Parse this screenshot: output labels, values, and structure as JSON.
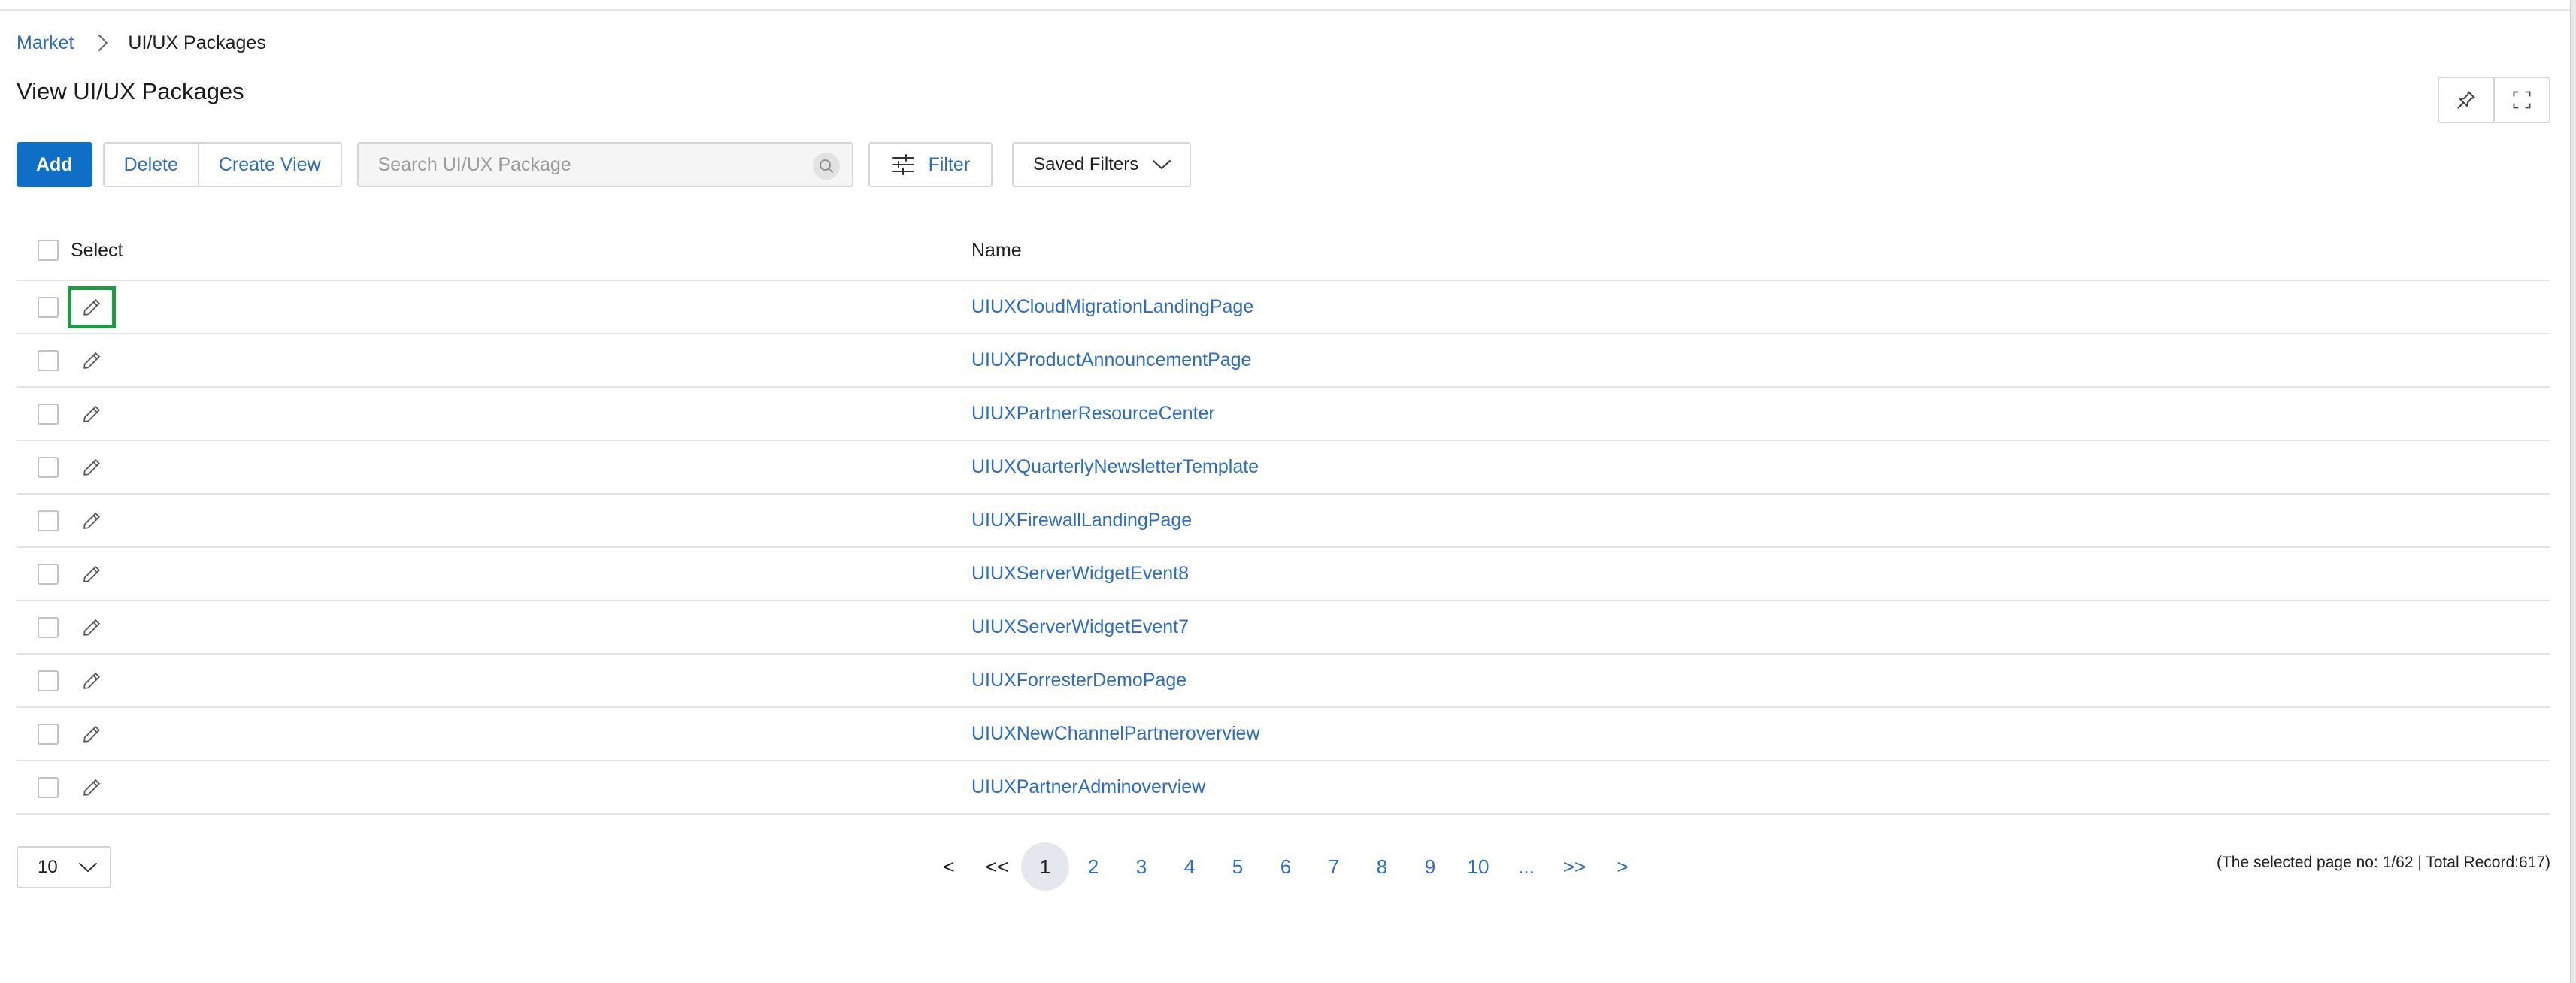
{
  "breadcrumb": {
    "parent": "Market",
    "current": "UI/UX Packages"
  },
  "page_title": "View UI/UX Packages",
  "toolbar": {
    "add_label": "Add",
    "delete_label": "Delete",
    "create_view_label": "Create View",
    "search_placeholder": "Search UI/UX Package",
    "filter_label": "Filter",
    "saved_filters_label": "Saved Filters"
  },
  "table": {
    "columns": [
      "Select",
      "Name"
    ],
    "rows": [
      {
        "name": "UIUXCloudMigrationLandingPage"
      },
      {
        "name": "UIUXProductAnnouncementPage"
      },
      {
        "name": "UIUXPartnerResourceCenter"
      },
      {
        "name": "UIUXQuarterlyNewsletterTemplate"
      },
      {
        "name": "UIUXFirewallLandingPage"
      },
      {
        "name": "UIUXServerWidgetEvent8"
      },
      {
        "name": "UIUXServerWidgetEvent7"
      },
      {
        "name": "UIUXForresterDemoPage"
      },
      {
        "name": "UIUXNewChannelPartneroverview"
      },
      {
        "name": "UIUXPartnerAdminoverview"
      }
    ]
  },
  "pagination": {
    "page_size": "10",
    "prev": "<",
    "first": "<<",
    "pages": [
      "1",
      "2",
      "3",
      "4",
      "5",
      "6",
      "7",
      "8",
      "9",
      "10"
    ],
    "current": "1",
    "ellipsis": "...",
    "last": ">>",
    "next": ">",
    "record_info": "(The selected page no: 1/62 | Total Record:617)"
  },
  "colors": {
    "accent": "#0f6fc6",
    "link": "#2b6cc4",
    "focus_highlight": "#1f9b3f"
  },
  "icons": [
    "chevron-right-icon",
    "pin-icon",
    "fullscreen-icon",
    "search-icon",
    "filter-sliders-icon",
    "chevron-down-icon",
    "pencil-edit-icon"
  ]
}
